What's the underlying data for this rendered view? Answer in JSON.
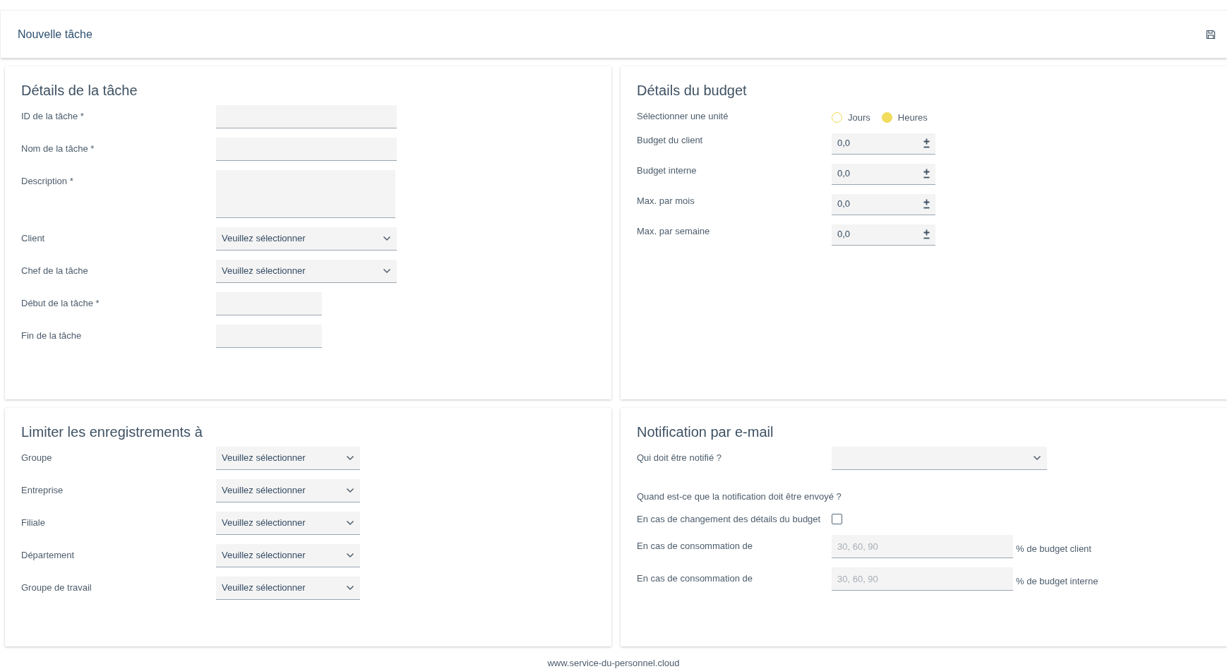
{
  "header": {
    "title": "Nouvelle tâche"
  },
  "task_details": {
    "title": "Détails de la tâche",
    "fields": [
      {
        "label": "ID de la tâche *",
        "kind": "text"
      },
      {
        "label": "Nom de la tâche *",
        "kind": "text"
      },
      {
        "label": "Description *",
        "kind": "textarea"
      },
      {
        "label": "Client",
        "kind": "select",
        "value": "Veuillez sélectionner"
      },
      {
        "label": "Chef de la tâche",
        "kind": "select",
        "value": "Veuillez sélectionner"
      },
      {
        "label": "Début de la tâche *",
        "kind": "date"
      },
      {
        "label": "Fin de la tâche",
        "kind": "date"
      }
    ]
  },
  "budget_details": {
    "title": "Détails du budget",
    "unit": {
      "label": "Sélectionner une unité",
      "options": [
        {
          "label": "Jours",
          "selected": false
        },
        {
          "label": "Heures",
          "selected": true
        }
      ]
    },
    "fields": [
      {
        "label": "Budget du client",
        "value": "0,0"
      },
      {
        "label": "Budget interne",
        "value": "0,0"
      },
      {
        "label": "Max. par mois",
        "value": "0,0"
      },
      {
        "label": "Max. par semaine",
        "value": "0,0"
      }
    ]
  },
  "limit_records": {
    "title": "Limiter les enregistrements à",
    "fields": [
      {
        "label": "Groupe",
        "value": "Veuillez sélectionner"
      },
      {
        "label": "Entreprise",
        "value": "Veuillez sélectionner"
      },
      {
        "label": "Filiale",
        "value": "Veuillez sélectionner"
      },
      {
        "label": "Département",
        "value": "Veuillez sélectionner"
      },
      {
        "label": "Groupe de travail",
        "value": "Veuillez sélectionner"
      }
    ]
  },
  "email_notification": {
    "title": "Notification par e-mail",
    "recipient": {
      "label": "Qui doit être notifié ?"
    },
    "when_label": "Quand est-ce que la notification doit être envoyé ?",
    "on_change": {
      "label": "En cas de changement des détails du budget",
      "checked": false
    },
    "thresholds": [
      {
        "label": "En cas de consommation de",
        "placeholder": "30, 60, 90",
        "suffix": "% de budget client"
      },
      {
        "label": "En cas de consommation de",
        "placeholder": "30, 60, 90",
        "suffix": "% de budget interne"
      }
    ]
  },
  "footer": {
    "text": "www.service-du-personnel.cloud"
  }
}
